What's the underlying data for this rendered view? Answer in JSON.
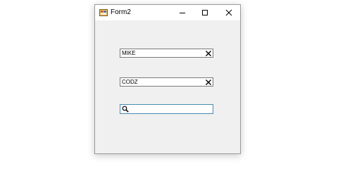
{
  "window": {
    "title": "Form2",
    "controls": [
      "minimize-icon",
      "maximize-icon",
      "close-icon"
    ]
  },
  "fields": [
    {
      "value": "MIKE",
      "clear_icon": "clear-x-icon"
    },
    {
      "value": "CODZ",
      "clear_icon": "clear-x-icon"
    }
  ],
  "search": {
    "value": "",
    "placeholder": "",
    "icon": "search-icon"
  },
  "colors": {
    "window_bg": "#f0f0f0",
    "titlebar_bg": "#ffffff",
    "focus_border": "#4a8ab0"
  }
}
